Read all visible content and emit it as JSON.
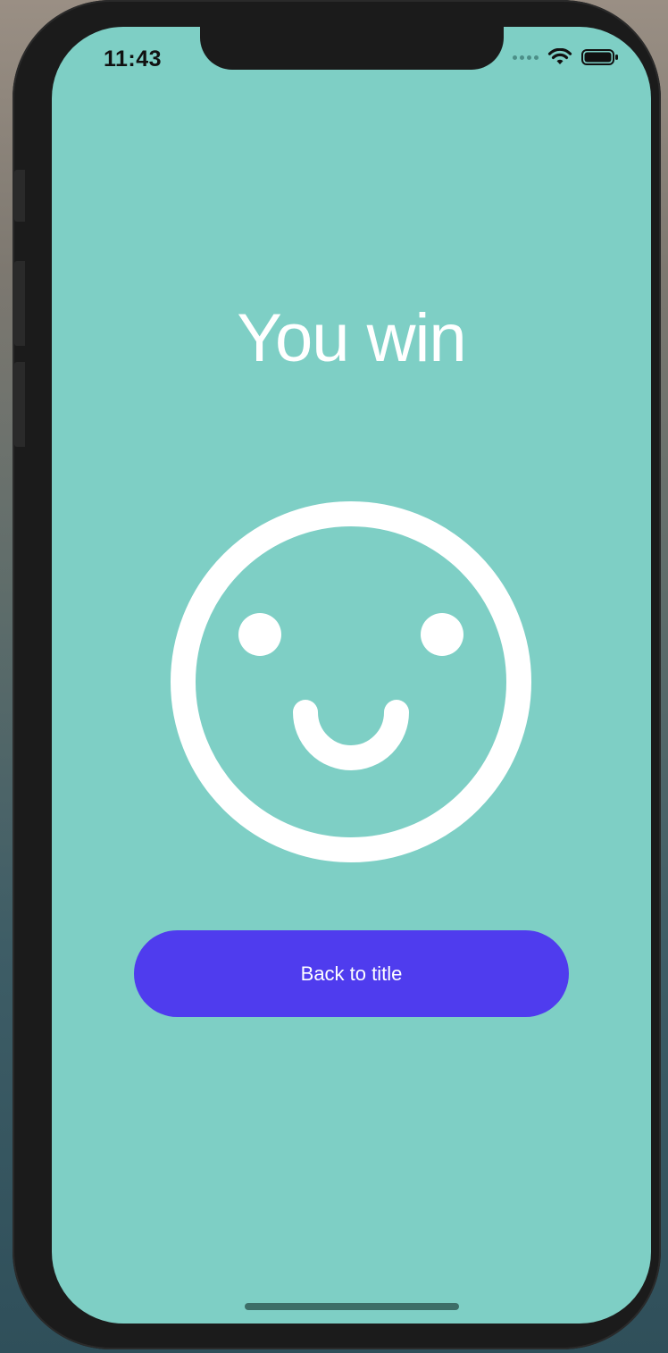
{
  "status_bar": {
    "time": "11:43",
    "icons": [
      "signal-dots-icon",
      "wifi-icon",
      "battery-icon"
    ]
  },
  "screen": {
    "title": "You win",
    "illustration": "smiley-face-icon",
    "back_button_label": "Back to title"
  },
  "colors": {
    "background": "#7ecfc5",
    "button": "#4f3cee",
    "foreground": "#ffffff",
    "device_frame": "#1b1b1b"
  }
}
